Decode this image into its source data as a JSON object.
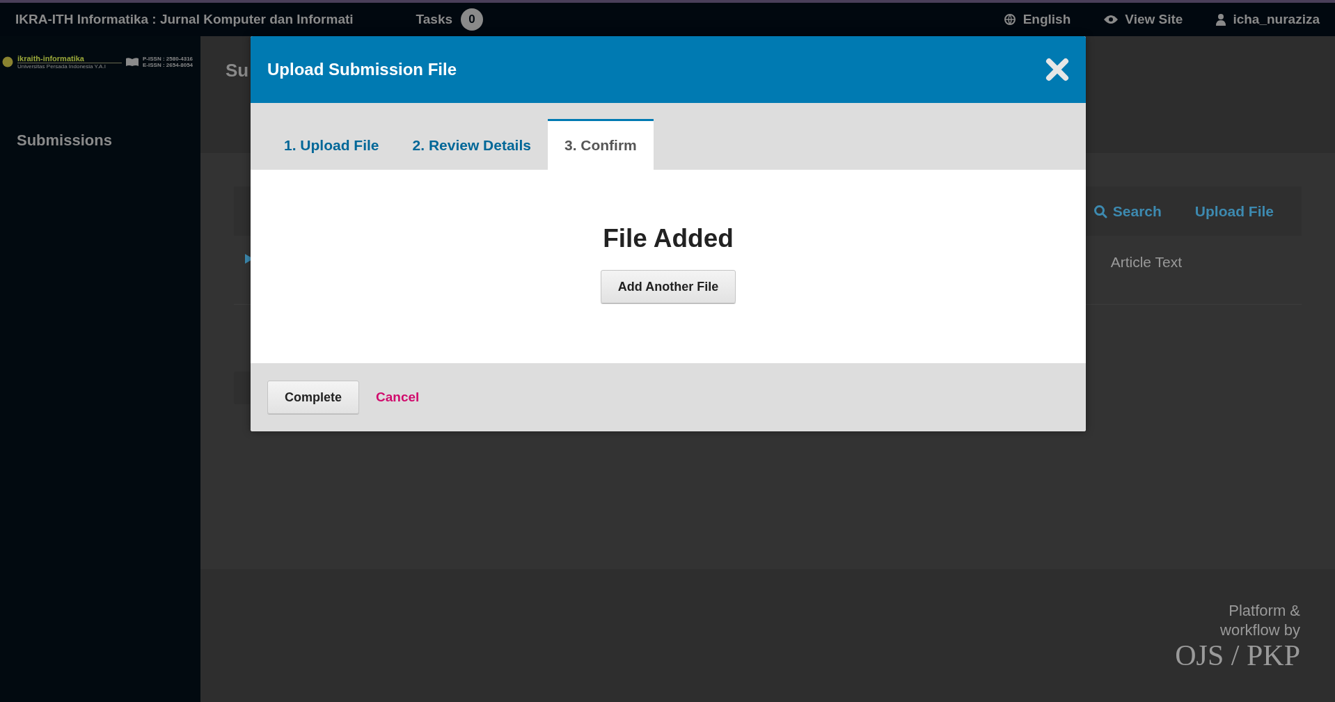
{
  "topbar": {
    "site_title": "IKRA-ITH Informatika : Jurnal Komputer dan Informati",
    "tasks_label": "Tasks",
    "tasks_count": "0",
    "language": "English",
    "view_site": "View Site",
    "user": "icha_nuraziza"
  },
  "sidebar": {
    "logo": {
      "name": "ikraith-informatika",
      "subtitle": "Universitas Persada Indonesia Y.A.I",
      "p_issn": "P-ISSN : 2580-4316",
      "e_issn": "E-ISSN : 2654-8054"
    },
    "items": [
      {
        "label": "Submissions"
      }
    ]
  },
  "page": {
    "heading": "Su",
    "files_panel": {
      "actions": [
        {
          "kind": "search",
          "label": "Search"
        },
        {
          "kind": "link",
          "label": "Upload File"
        }
      ],
      "rows": [
        {
          "expanded": false,
          "column_3": "Article Text"
        }
      ]
    }
  },
  "footer": {
    "platform_text": "Platform &\nworkflow by",
    "logo": "OJS / PKP"
  },
  "modal": {
    "title": "Upload Submission File",
    "tabs": [
      {
        "label": "1. Upload File",
        "selected": false
      },
      {
        "label": "2. Review Details",
        "selected": false
      },
      {
        "label": "3. Confirm",
        "selected": true
      }
    ],
    "message": "File Added",
    "add_button": "Add Another File",
    "buttons": [
      {
        "kind": "primary",
        "label": "Complete"
      },
      {
        "kind": "cancel",
        "label": "Cancel"
      }
    ]
  }
}
